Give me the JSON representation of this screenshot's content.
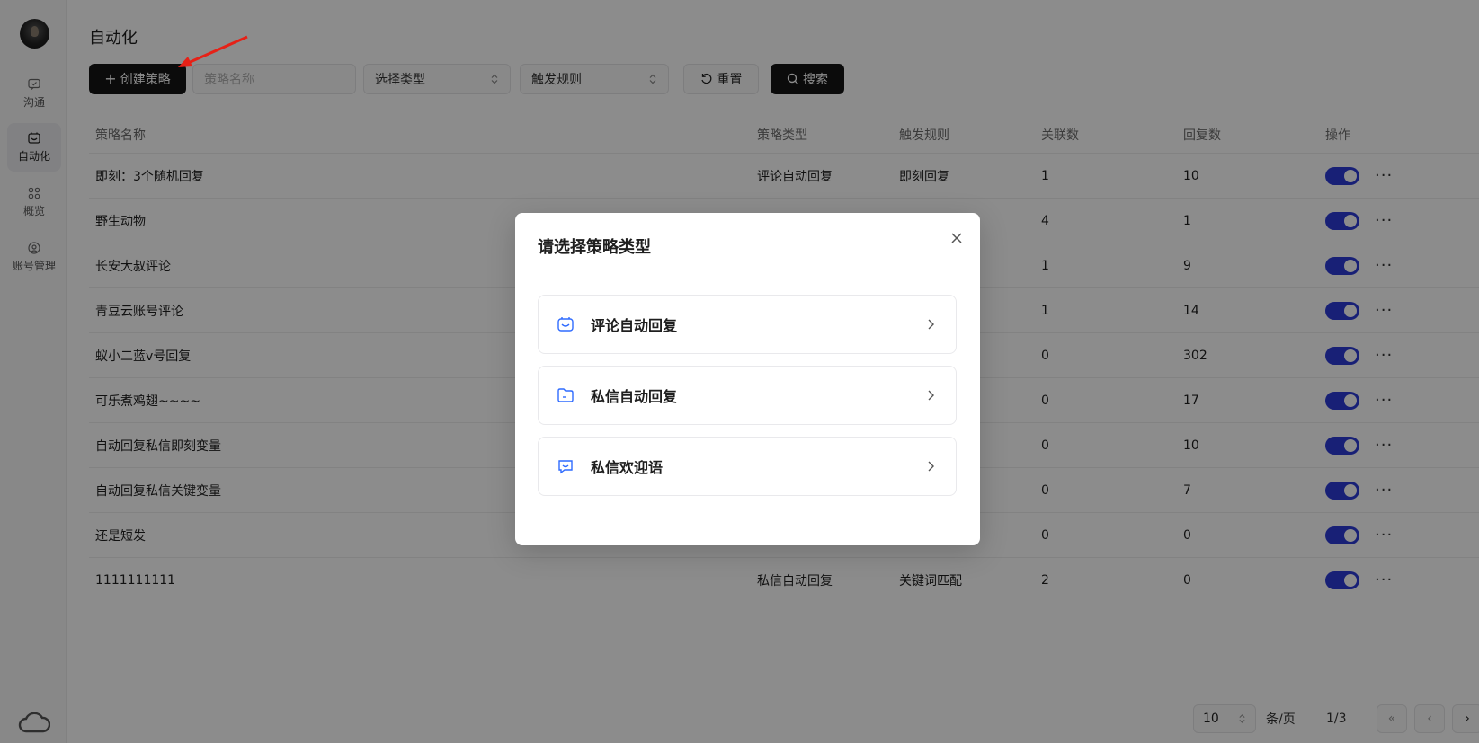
{
  "sidebar": {
    "items": [
      {
        "label": "沟通",
        "icon": "chat-check-icon"
      },
      {
        "label": "自动化",
        "icon": "automation-icon",
        "active": true
      },
      {
        "label": "概览",
        "icon": "grid-icon"
      },
      {
        "label": "账号管理",
        "icon": "account-icon"
      }
    ]
  },
  "page": {
    "title": "自动化"
  },
  "toolbar": {
    "create_label": "创建策略",
    "name_placeholder": "策略名称",
    "type_select": "选择类型",
    "rule_select": "触发规则",
    "reset_label": "重置",
    "search_label": "搜索"
  },
  "table": {
    "headers": {
      "name": "策略名称",
      "type": "策略类型",
      "rule": "触发规则",
      "assoc": "关联数",
      "reply": "回复数",
      "op": "操作"
    },
    "rows": [
      {
        "name": "即刻：3个随机回复",
        "type": "评论自动回复",
        "rule": "即刻回复",
        "assoc": "1",
        "reply": "10",
        "enabled": true
      },
      {
        "name": "野生动物",
        "type": "",
        "rule": "",
        "assoc": "4",
        "reply": "1",
        "enabled": true
      },
      {
        "name": "长安大叔评论",
        "type": "",
        "rule": "",
        "assoc": "1",
        "reply": "9",
        "enabled": true
      },
      {
        "name": "青豆云账号评论",
        "type": "",
        "rule": "",
        "assoc": "1",
        "reply": "14",
        "enabled": true
      },
      {
        "name": "蚁小二蓝v号回复",
        "type": "",
        "rule": "",
        "assoc": "0",
        "reply": "302",
        "enabled": true
      },
      {
        "name": "可乐煮鸡翅~~~~",
        "type": "",
        "rule": "",
        "assoc": "0",
        "reply": "17",
        "enabled": true
      },
      {
        "name": "自动回复私信即刻变量",
        "type": "",
        "rule": "",
        "assoc": "0",
        "reply": "10",
        "enabled": true
      },
      {
        "name": "自动回复私信关键变量",
        "type": "",
        "rule": "",
        "assoc": "0",
        "reply": "7",
        "enabled": true
      },
      {
        "name": "还是短发",
        "type": "",
        "rule": "",
        "assoc": "0",
        "reply": "0",
        "enabled": true
      },
      {
        "name": "1111111111",
        "type": "私信自动回复",
        "rule": "关键词匹配",
        "assoc": "2",
        "reply": "0",
        "enabled": true
      }
    ]
  },
  "pagination": {
    "page_size": "10",
    "per_page_label": "条/页",
    "page_indicator": "1/3"
  },
  "modal": {
    "title": "请选择策略类型",
    "options": [
      {
        "label": "评论自动回复",
        "icon": "comment-inbox-icon"
      },
      {
        "label": "私信自动回复",
        "icon": "message-folder-icon"
      },
      {
        "label": "私信欢迎语",
        "icon": "welcome-message-icon"
      }
    ]
  },
  "colors": {
    "primary_button": "#141414",
    "toggle_on": "#2d3bd8",
    "option_icon": "#2f6bff",
    "annotation_arrow": "#e62117"
  }
}
